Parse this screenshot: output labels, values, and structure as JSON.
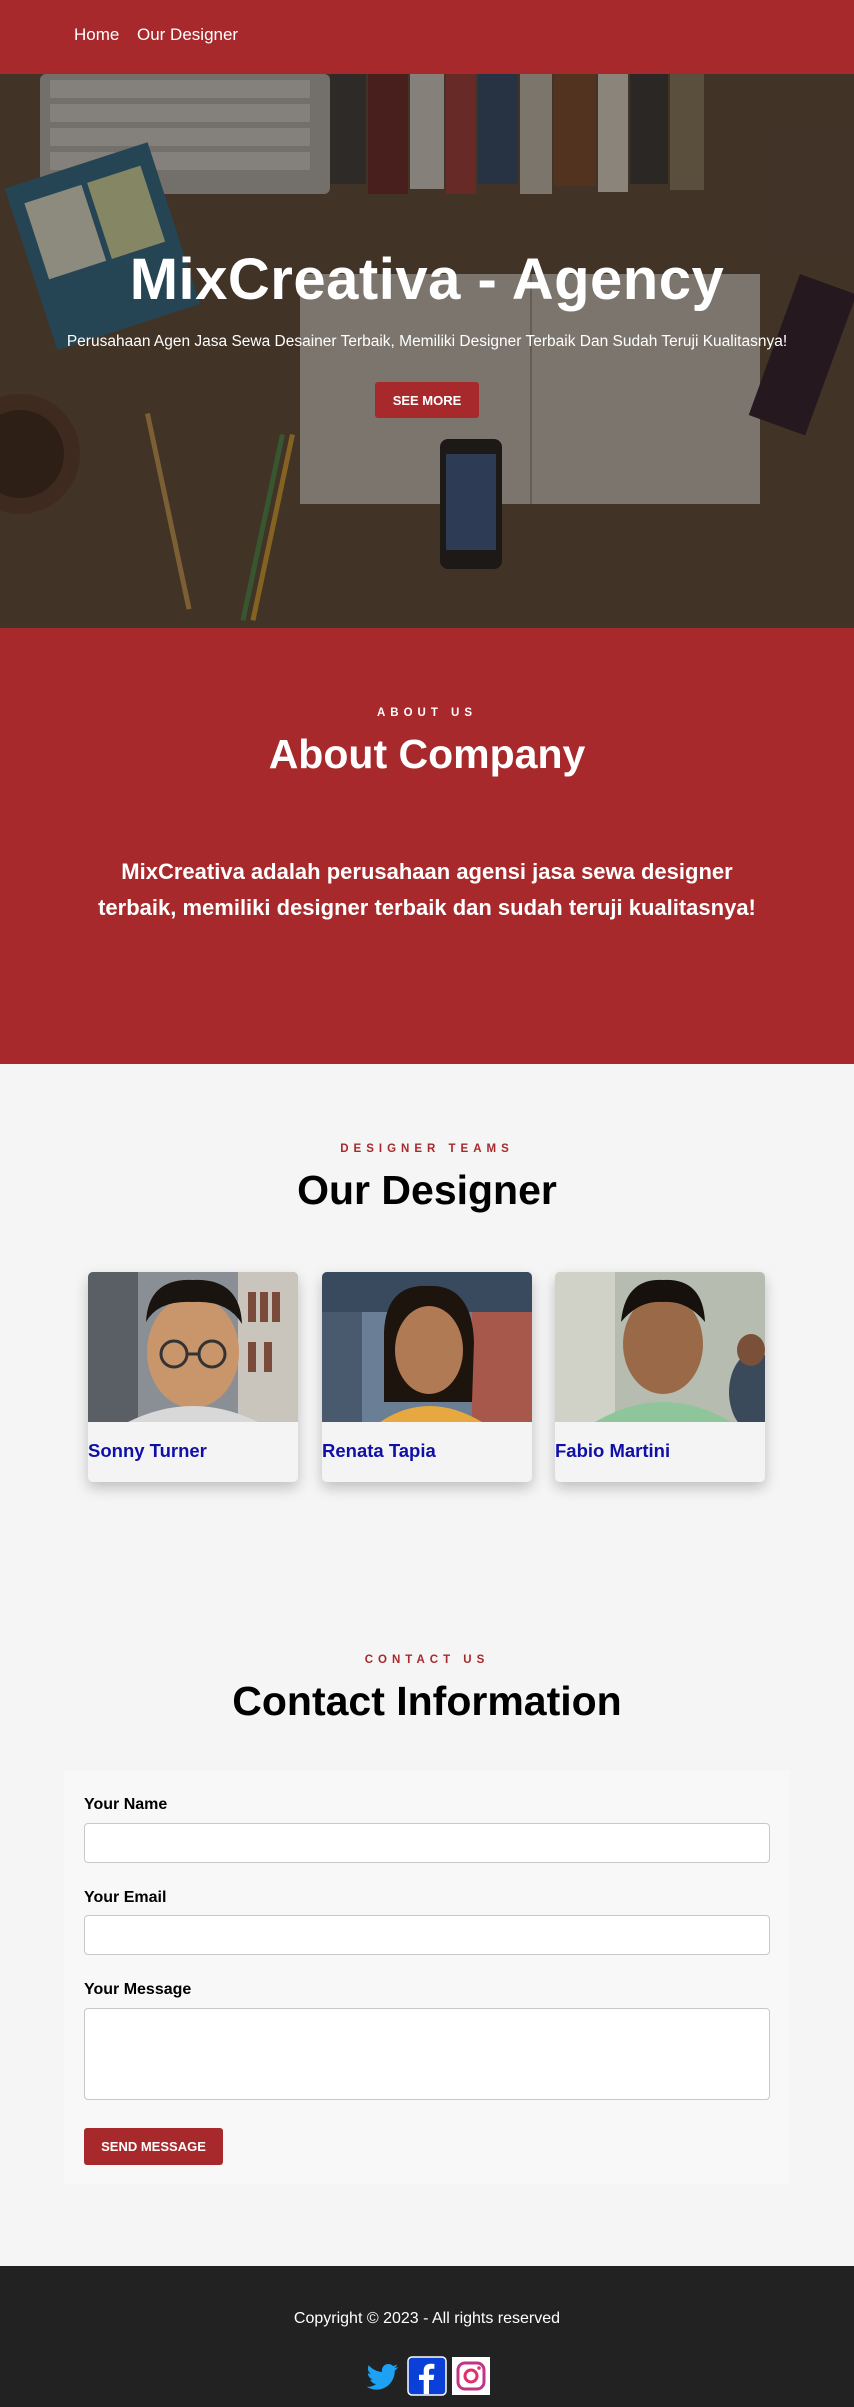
{
  "nav": {
    "home": "Home",
    "designer": "Our Designer",
    "color": "#a8292c"
  },
  "hero": {
    "title": "MixCreativa - Agency",
    "subtitle": "Perusahaan Agen Jasa Sewa Desainer Terbaik, Memiliki Designer Terbaik Dan Sudah Teruji Kualitasnya!",
    "button": "SEE MORE"
  },
  "about": {
    "eyebrow": "ABOUT US",
    "title": "About Company",
    "text": "MixCreativa adalah perusahaan agensi jasa sewa designer terbaik, memiliki designer terbaik dan sudah teruji kualitasnya!"
  },
  "designers": {
    "eyebrow": "DESIGNER TEAMS",
    "title": "Our Designer",
    "cards": [
      {
        "name": "Sonny Turner"
      },
      {
        "name": "Renata Tapia"
      },
      {
        "name": "Fabio Martini"
      }
    ]
  },
  "contact": {
    "eyebrow": "CONTACT US",
    "title": "Contact Information",
    "name_label": "Your Name",
    "email_label": "Your Email",
    "message_label": "Your Message",
    "name_value": "",
    "email_value": "",
    "message_value": "",
    "button": "SEND MESSAGE"
  },
  "footer": {
    "copyright": "Copyright © 2023 - All rights reserved",
    "social_icons": [
      "twitter-icon",
      "facebook-icon",
      "instagram-icon"
    ]
  },
  "colors": {
    "brand_red": "#a8292c",
    "name_blue": "#1010a8",
    "footer_bg": "#222222"
  }
}
